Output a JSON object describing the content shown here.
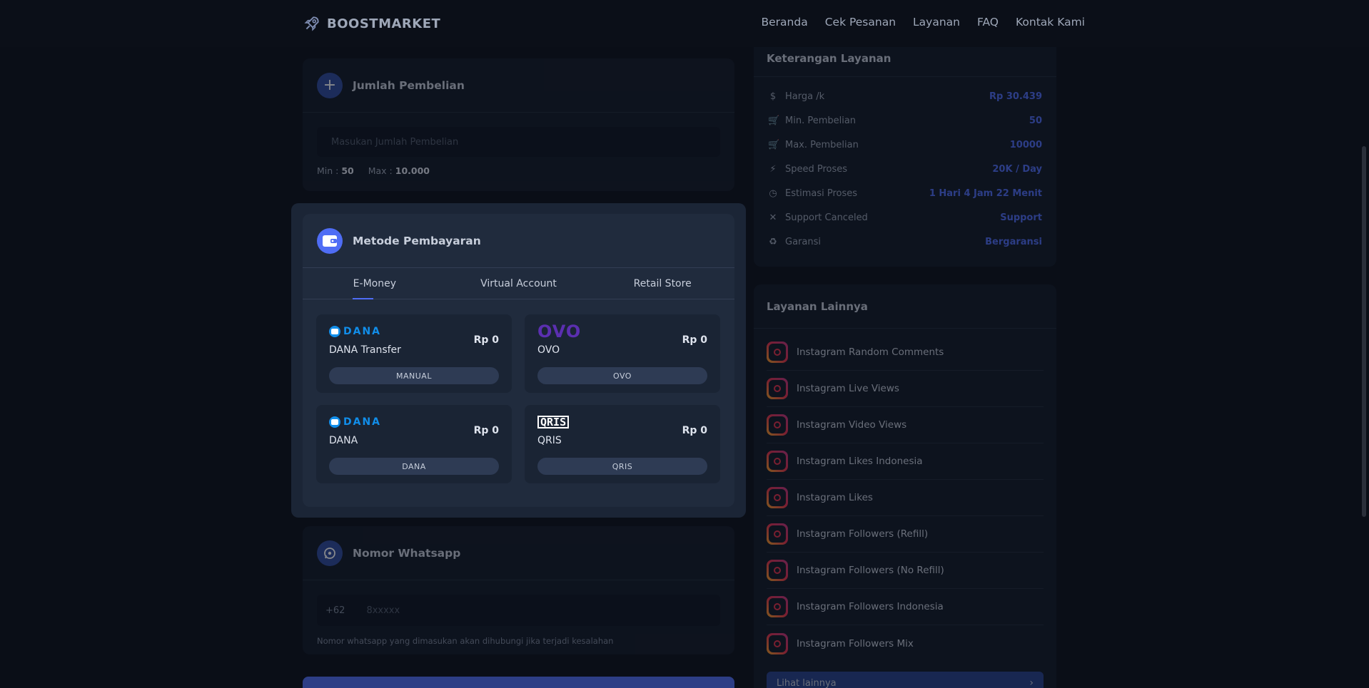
{
  "brand": {
    "name": "BOOSTMARKET"
  },
  "nav": [
    "Beranda",
    "Cek Pesanan",
    "Layanan",
    "FAQ",
    "Kontak Kami"
  ],
  "jumlah": {
    "title": "Jumlah Pembelian",
    "placeholder": "Masukan Jumlah Pembelian",
    "min_label": "Min :",
    "min_value": "50",
    "max_label": "Max :",
    "max_value": "10.000"
  },
  "payment": {
    "title": "Metode Pembayaran",
    "tabs": [
      "E-Money",
      "Virtual Account",
      "Retail Store"
    ],
    "active_tab": 0,
    "methods": [
      {
        "logo": "DANA",
        "name": "DANA Transfer",
        "price": "Rp 0",
        "tag": "MANUAL"
      },
      {
        "logo": "OVO",
        "name": "OVO",
        "price": "Rp 0",
        "tag": "OVO"
      },
      {
        "logo": "DANA",
        "name": "DANA",
        "price": "Rp 0",
        "tag": "DANA"
      },
      {
        "logo": "QRIS",
        "name": "QRIS",
        "price": "Rp 0",
        "tag": "QRIS"
      }
    ]
  },
  "whatsapp": {
    "title": "Nomor Whatsapp",
    "prefix": "+62",
    "placeholder": "8xxxxx",
    "hint": "Nomor whatsapp yang dimasukan akan dihubungi jika terjadi kesalahan"
  },
  "keterangan": {
    "title": "Keterangan Layanan",
    "rows": [
      {
        "icon": "dollar-icon",
        "label": "Harga /k",
        "value": "Rp 30.439"
      },
      {
        "icon": "cart-icon",
        "label": "Min. Pembelian",
        "value": "50"
      },
      {
        "icon": "cart-icon",
        "label": "Max. Pembelian",
        "value": "10000"
      },
      {
        "icon": "bolt-icon",
        "label": "Speed Proses",
        "value": "20K / Day"
      },
      {
        "icon": "clock-icon",
        "label": "Estimasi Proses",
        "value": "1 Hari 4 Jam 22 Menit"
      },
      {
        "icon": "close-icon",
        "label": "Support Canceled",
        "value": "Support"
      },
      {
        "icon": "recycle-icon",
        "label": "Garansi",
        "value": "Bergaransi"
      }
    ]
  },
  "lainnya": {
    "title": "Layanan Lainnya",
    "items": [
      "Instagram Random Comments",
      "Instagram Live Views",
      "Instagram Video Views",
      "Instagram Likes Indonesia",
      "Instagram Likes",
      "Instagram Followers (Refill)",
      "Instagram Followers (No Refill)",
      "Instagram Followers Indonesia",
      "Instagram Followers Mix"
    ],
    "more_label": "Lihat lainnya"
  }
}
